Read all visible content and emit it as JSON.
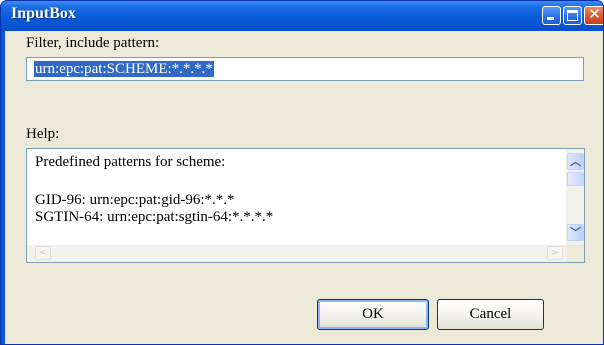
{
  "window": {
    "title": "InputBox",
    "controls": {
      "minimize": "minimize-icon",
      "maximize": "maximize-icon",
      "close": "close-icon"
    },
    "colors": {
      "titlebar": "#0a56d8",
      "client": "#ece9d8",
      "selection": "#316ac5",
      "close_button": "#d9552e"
    }
  },
  "filter": {
    "label": "Filter, include pattern:",
    "value": "urn:epc:pat:SCHEME:*.*.*.*"
  },
  "help": {
    "label": "Help:",
    "lines": [
      "Predefined patterns for scheme:",
      "GID-96: urn:epc:pat:gid-96:*.*.*",
      "SGTIN-64: urn:epc:pat:sgtin-64:*.*.*.*"
    ]
  },
  "buttons": {
    "ok": "OK",
    "cancel": "Cancel"
  }
}
